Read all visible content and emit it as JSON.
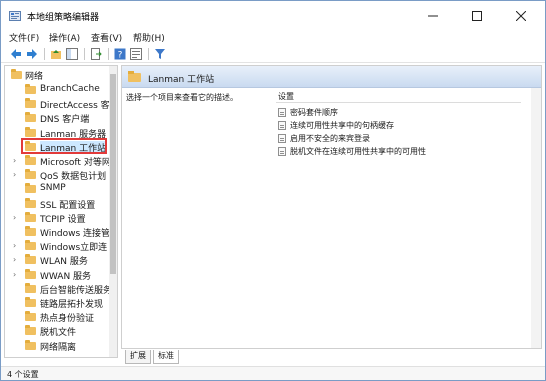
{
  "window": {
    "title": "本地组策略编辑器",
    "accent": "#2f6fb8"
  },
  "menu": [
    "文件(F)",
    "操作(A)",
    "查看(V)",
    "帮助(H)"
  ],
  "toolbar": {
    "icons": [
      "back-arrow-icon",
      "forward-arrow-icon",
      "up-folder-icon",
      "show-hide-tree-icon",
      "export-list-icon",
      "help-icon",
      "properties-icon",
      "filter-icon"
    ]
  },
  "tree": {
    "root": "网络",
    "items": [
      {
        "label": "BranchCache",
        "expandable": false
      },
      {
        "label": "DirectAccess 客",
        "expandable": false
      },
      {
        "label": "DNS 客户端",
        "expandable": false
      },
      {
        "label": "Lanman 服务器",
        "expandable": false
      },
      {
        "label": "Lanman 工作站",
        "expandable": false,
        "selected": true
      },
      {
        "label": "Microsoft 对等网",
        "expandable": true
      },
      {
        "label": "QoS 数据包计划",
        "expandable": true
      },
      {
        "label": "SNMP",
        "expandable": false
      },
      {
        "label": "SSL 配置设置",
        "expandable": false
      },
      {
        "label": "TCPIP 设置",
        "expandable": true
      },
      {
        "label": "Windows 连接管",
        "expandable": false
      },
      {
        "label": "Windows立即连",
        "expandable": true
      },
      {
        "label": "WLAN 服务",
        "expandable": true
      },
      {
        "label": "WWAN 服务",
        "expandable": true
      },
      {
        "label": "后台智能传送服务",
        "expandable": false
      },
      {
        "label": "链路层拓扑发现",
        "expandable": false
      },
      {
        "label": "热点身份验证",
        "expandable": false
      },
      {
        "label": "脱机文件",
        "expandable": false
      },
      {
        "label": "网络隔离",
        "expandable": false
      }
    ]
  },
  "content": {
    "header_title": "Lanman 工作站",
    "description": "选择一个项目来查看它的描述。",
    "column_title": "设置",
    "settings": [
      "密码套件顺序",
      "连续可用性共享中的句柄缓存",
      "启用不安全的来宾登录",
      "脱机文件在连续可用性共享中的可用性"
    ]
  },
  "tabs": [
    "扩展",
    "标准"
  ],
  "status": "4 个设置"
}
